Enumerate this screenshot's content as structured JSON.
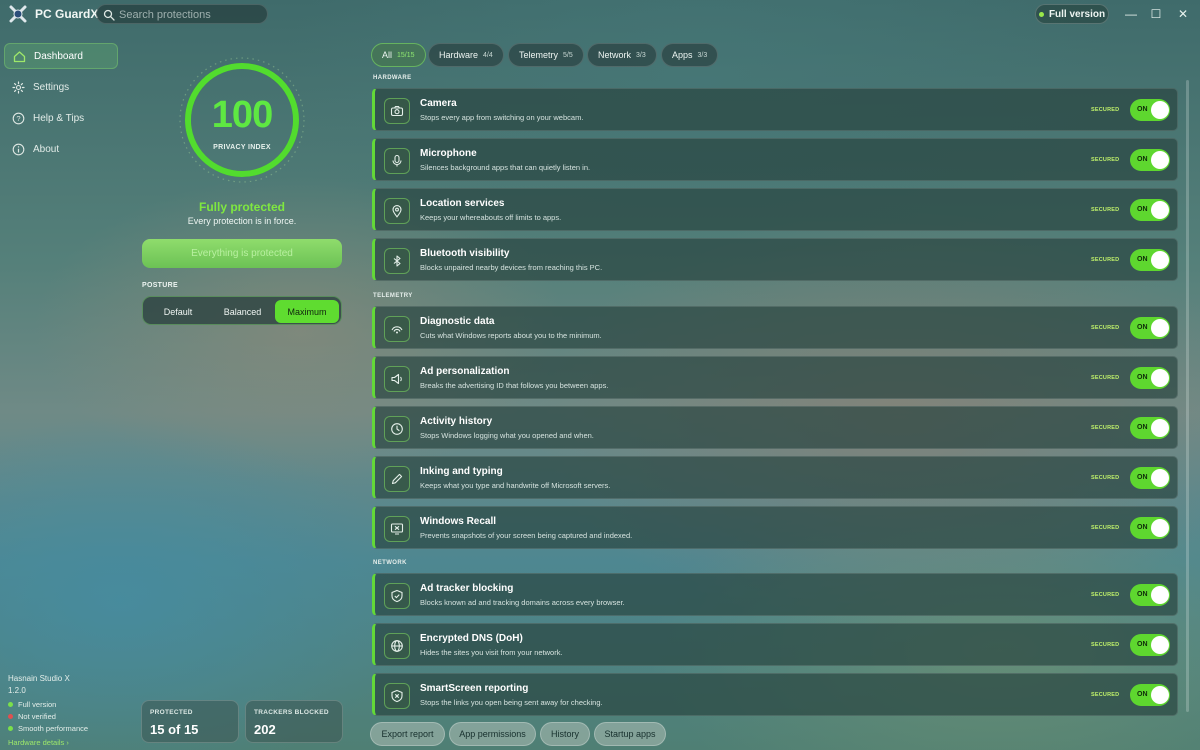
{
  "titlebar": {
    "app_name": "PC GuardX",
    "search_placeholder": "Search protections",
    "full_version_badge": "Full version",
    "minimize_glyph": "—",
    "maximize_glyph": "☐",
    "close_glyph": "✕"
  },
  "sidebar": {
    "items": [
      {
        "label": "Dashboard",
        "icon": "home-icon",
        "active": true
      },
      {
        "label": "Settings",
        "icon": "gear-icon",
        "active": false
      },
      {
        "label": "Help & Tips",
        "icon": "help-icon",
        "active": false
      },
      {
        "label": "About",
        "icon": "info-icon",
        "active": false
      }
    ],
    "studio": "Hasnain Studio X",
    "version": "1.2.0",
    "legend": [
      {
        "label": "Full version",
        "color": "#7be04a"
      },
      {
        "label": "Not verified",
        "color": "#e05050"
      },
      {
        "label": "Smooth performance",
        "color": "#7be04a"
      }
    ],
    "hardware_link": "Hardware details ›"
  },
  "overview": {
    "score": "100",
    "score_fraction": 1.0,
    "score_label": "PRIVACY INDEX",
    "status_title": "Fully protected",
    "status_subtitle": "Every protection is in force.",
    "primary_button": "Everything is protected",
    "posture_label": "POSTURE",
    "posture_options": [
      "Default",
      "Balanced",
      "Maximum"
    ],
    "posture_selected": "Maximum",
    "stats": [
      {
        "label": "PROTECTED",
        "value": "15 of 15"
      },
      {
        "label": "TRACKERS BLOCKED",
        "value": "202"
      }
    ]
  },
  "filters": [
    {
      "label": "All",
      "count": "15/15",
      "active": true
    },
    {
      "label": "Hardware",
      "count": "4/4",
      "active": false
    },
    {
      "label": "Telemetry",
      "count": "5/5",
      "active": false
    },
    {
      "label": "Network",
      "count": "3/3",
      "active": false
    },
    {
      "label": "Apps",
      "count": "3/3",
      "active": false
    }
  ],
  "sections": [
    {
      "title": "HARDWARE"
    },
    {
      "title": "TELEMETRY"
    },
    {
      "title": "NETWORK"
    }
  ],
  "cards": [
    {
      "title": "Camera",
      "desc": "Stops every app from switching on your webcam.",
      "icon": "camera-icon",
      "badge": "SECURED",
      "toggle": "ON"
    },
    {
      "title": "Microphone",
      "desc": "Silences background apps that can quietly listen in.",
      "icon": "microphone-icon",
      "badge": "SECURED",
      "toggle": "ON"
    },
    {
      "title": "Location services",
      "desc": "Keeps your whereabouts off limits to apps.",
      "icon": "location-pin-icon",
      "badge": "SECURED",
      "toggle": "ON"
    },
    {
      "title": "Bluetooth visibility",
      "desc": "Blocks unpaired nearby devices from reaching this PC.",
      "icon": "bluetooth-icon",
      "badge": "SECURED",
      "toggle": "ON"
    },
    {
      "title": "Diagnostic data",
      "desc": "Cuts what Windows reports about you to the minimum.",
      "icon": "signal-icon",
      "badge": "SECURED",
      "toggle": "ON"
    },
    {
      "title": "Ad personalization",
      "desc": "Breaks the advertising ID that follows you between apps.",
      "icon": "megaphone-icon",
      "badge": "SECURED",
      "toggle": "ON"
    },
    {
      "title": "Activity history",
      "desc": "Stops Windows logging what you opened and when.",
      "icon": "clock-icon",
      "badge": "SECURED",
      "toggle": "ON"
    },
    {
      "title": "Inking and typing",
      "desc": "Keeps what you type and handwrite off Microsoft servers.",
      "icon": "pen-icon",
      "badge": "SECURED",
      "toggle": "ON"
    },
    {
      "title": "Windows Recall",
      "desc": "Prevents snapshots of your screen being captured and indexed.",
      "icon": "screen-x-icon",
      "badge": "SECURED",
      "toggle": "ON"
    },
    {
      "title": "Ad tracker blocking",
      "desc": "Blocks known ad and tracking domains across every browser.",
      "icon": "shield-check-icon",
      "badge": "SECURED",
      "toggle": "ON"
    },
    {
      "title": "Encrypted DNS (DoH)",
      "desc": "Hides the sites you visit from your network.",
      "icon": "globe-icon",
      "badge": "SECURED",
      "toggle": "ON"
    },
    {
      "title": "SmartScreen reporting",
      "desc": "Stops the links you open being sent away for checking.",
      "icon": "shield-x-icon",
      "badge": "SECURED",
      "toggle": "ON"
    }
  ],
  "bottom_buttons": [
    "Export report",
    "App permissions",
    "History",
    "Startup apps"
  ],
  "colors": {
    "accent": "#5ed72f",
    "secured": "#bff06a",
    "not_verified": "#e05050"
  }
}
